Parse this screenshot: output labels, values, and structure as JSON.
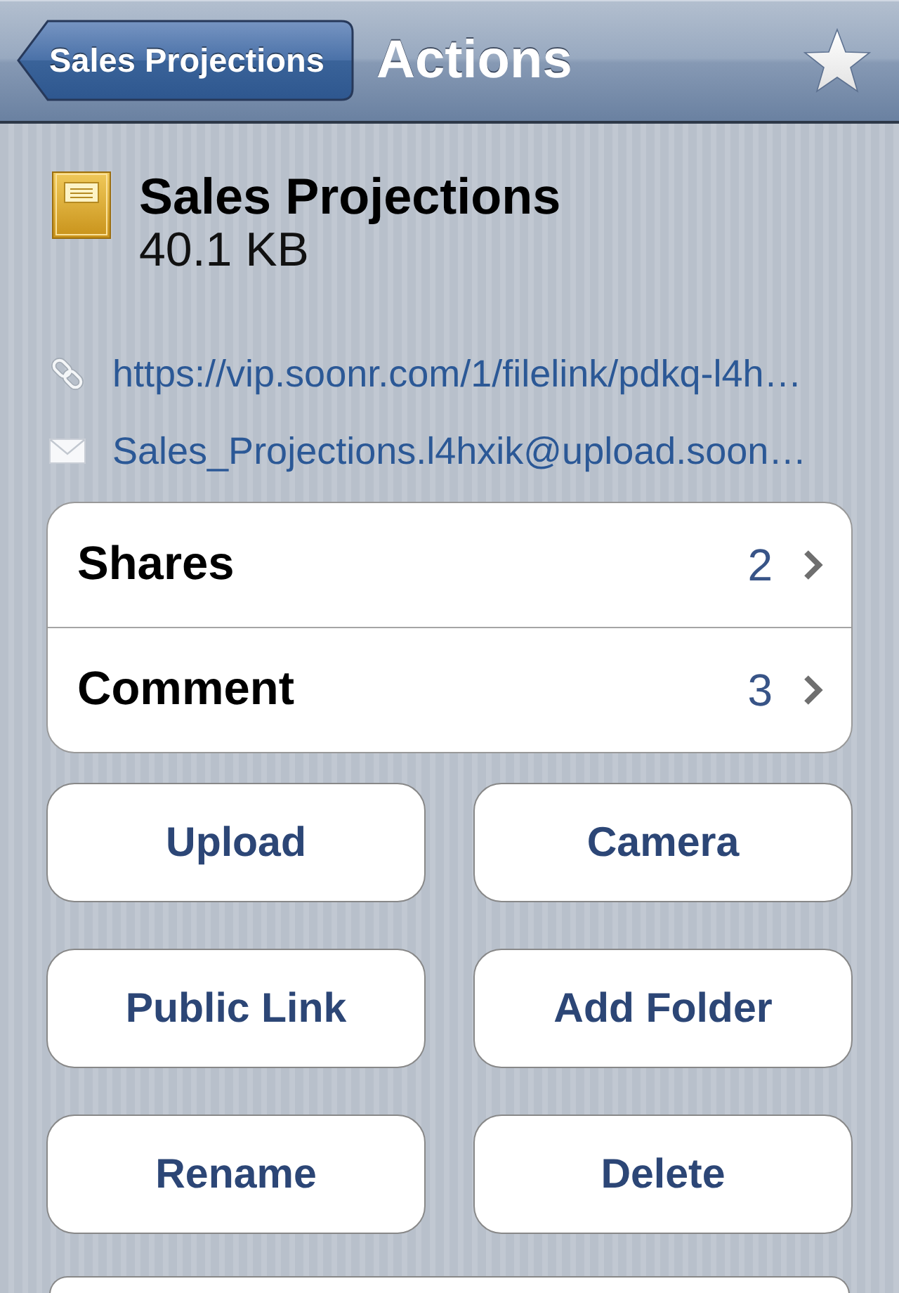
{
  "nav_bar": {
    "back_button": "Sales Projections",
    "title": "Actions"
  },
  "file": {
    "name": "Sales Projections",
    "size": "40.1 KB"
  },
  "links": [
    {
      "kind": "link",
      "text": "https://vip.soonr.com/1/filelink/pdkq-l4h…"
    },
    {
      "kind": "email",
      "text": "Sales_Projections.l4hxik@upload.soon…"
    }
  ],
  "detail_rows": [
    {
      "label": "Shares",
      "count": "2"
    },
    {
      "label": "Comment",
      "count": "3"
    }
  ],
  "buttons": [
    "Upload",
    "Camera",
    "Public Link",
    "Add Folder",
    "Rename",
    "Delete"
  ]
}
